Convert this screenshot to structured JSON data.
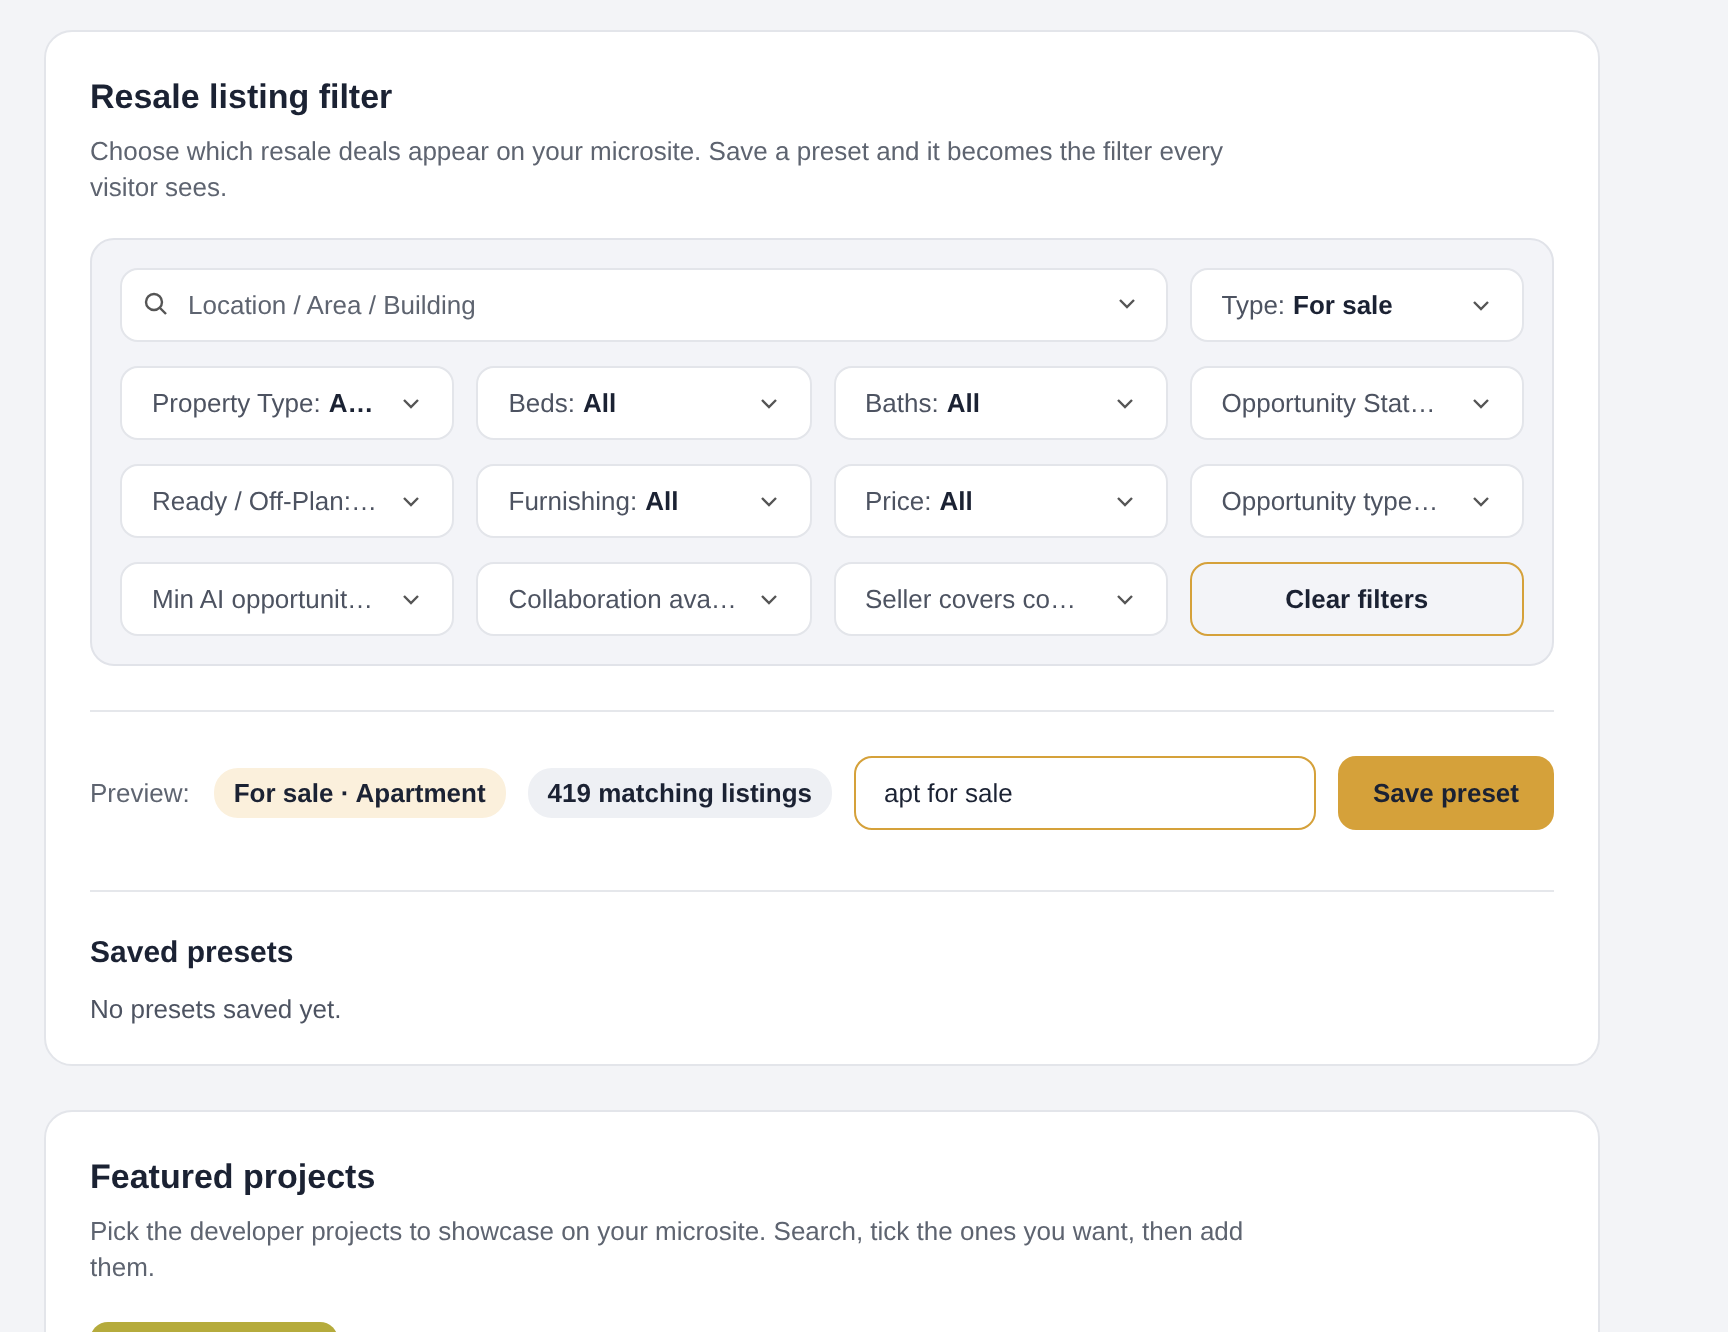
{
  "resale_filter": {
    "title": "Resale listing filter",
    "description": "Choose which resale deals appear on your microsite. Save a preset and it becomes the filter every visitor sees.",
    "search": {
      "placeholder": "Location / Area / Building"
    },
    "filters": [
      {
        "label": "Type:",
        "value": "For sale"
      },
      {
        "label": "Property Type:",
        "value": "A…"
      },
      {
        "label": "Beds:",
        "value": "All"
      },
      {
        "label": "Baths:",
        "value": "All"
      },
      {
        "label": "Opportunity Stat…"
      },
      {
        "label": "Ready / Off-Plan:…"
      },
      {
        "label": "Furnishing:",
        "value": "All"
      },
      {
        "label": "Price:",
        "value": "All"
      },
      {
        "label": "Opportunity type…"
      },
      {
        "label": "Min AI opportunit…"
      },
      {
        "label": "Collaboration ava…"
      },
      {
        "label": "Seller covers co…"
      }
    ],
    "clear_button": "Clear filters",
    "preview": {
      "label": "Preview:",
      "chips": [
        {
          "text": "For sale · Apartment",
          "kind": "accent"
        },
        {
          "text": "419 matching listings",
          "kind": "neutral"
        }
      ]
    },
    "preset_name": {
      "value": "apt for sale"
    },
    "save_button": "Save preset",
    "saved_presets": {
      "title": "Saved presets",
      "empty_text": "No presets saved yet."
    }
  },
  "featured_projects": {
    "title": "Featured projects",
    "description": "Pick the developer projects to showcase on your microsite. Search, tick the ones you want, then add them."
  }
}
